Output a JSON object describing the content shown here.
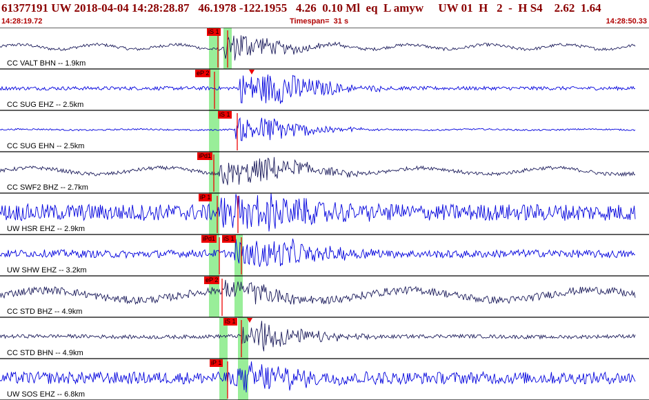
{
  "header": {
    "title": "61377191 UW 2018-04-04 14:28:28.87   46.1978 -122.1955   4.26  0.10 Ml  eq  L amyw     UW 01  H   2  -  H S4    2.62  1.64",
    "time_start": "14:28:19.72",
    "timespan": "Timespan=  31 s",
    "time_end": "14:28:50.33"
  },
  "colors": {
    "dark_trace": "#1a1a5a",
    "blue_trace": "#0000dd",
    "pick_red": "#ee0000",
    "window_green": "#99ee99",
    "title_red": "#8b0000"
  },
  "channels": [
    {
      "label": "CC VALT BHN -- 1.9km",
      "color": "dark",
      "picks": [
        "iS 1"
      ]
    },
    {
      "label": "CC SUG EHZ -- 2.5km",
      "color": "blue",
      "picks": [
        "eP 2"
      ]
    },
    {
      "label": "CC SUG EHN -- 2.5km",
      "color": "blue",
      "picks": [
        "iS 1"
      ]
    },
    {
      "label": "CC SWF2 BHZ -- 2.7km",
      "color": "dark",
      "picks": [
        "iPd1"
      ]
    },
    {
      "label": "UW HSR EHZ -- 2.9km",
      "color": "blue",
      "picks": [
        "iP 1"
      ]
    },
    {
      "label": "UW SHW EHZ -- 3.2km",
      "color": "blue",
      "picks": [
        "iPd1",
        "iS 1"
      ]
    },
    {
      "label": "CC STD BHZ -- 4.9km",
      "color": "dark",
      "picks": [
        "eP 2"
      ]
    },
    {
      "label": "CC STD BHN -- 4.9km",
      "color": "dark",
      "picks": [
        "iS 1"
      ]
    },
    {
      "label": "UW SOS EHZ -- 6.8km",
      "color": "blue",
      "picks": [
        "iP 1"
      ]
    }
  ]
}
